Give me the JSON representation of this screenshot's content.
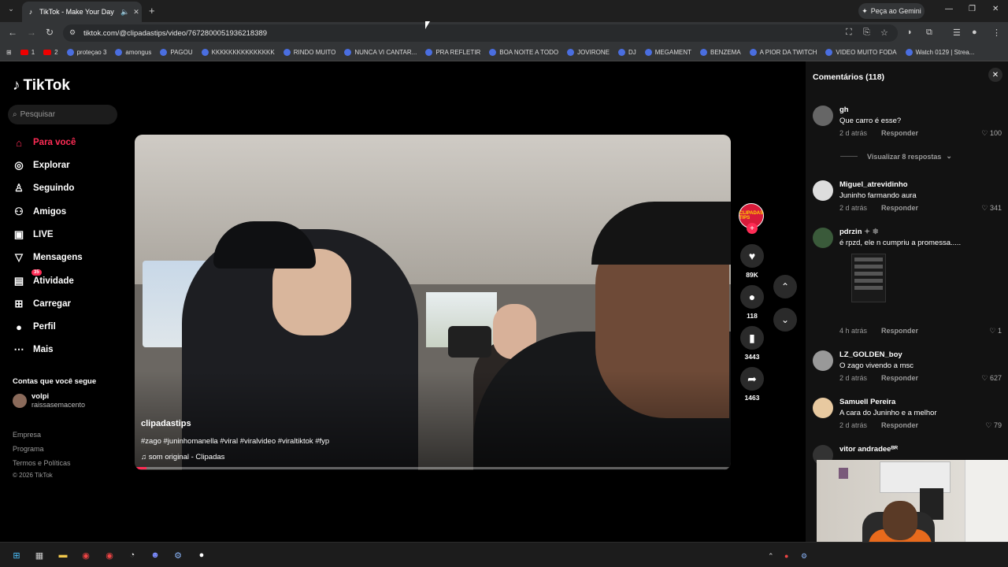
{
  "browser": {
    "tab_title": "TikTok - Make Your Day",
    "url": "tiktok.com/@clipadastips/video/7672800051936218389",
    "gemini_label": "Peça ao Gemini",
    "bookmarks": [
      "1",
      "2",
      "proteçao 3",
      "amongus",
      "PAGOU",
      "KKKKKKKKKKKKKKK",
      "RINDO MUITO",
      "NUNCA VI CANTAR...",
      "PRA REFLETIR",
      "BOA NOITE A TODO",
      "JOVIRONE",
      "DJ",
      "MEGAMENT",
      "BENZEMA",
      "A PIOR DA TWITCH",
      "VIDEO MUITO FODA",
      "Watch 0129 | Strea..."
    ]
  },
  "sidebar": {
    "logo": "TikTok",
    "search_placeholder": "Pesquisar",
    "items": [
      {
        "label": "Para você",
        "icon": "home-icon"
      },
      {
        "label": "Explorar",
        "icon": "compass-icon"
      },
      {
        "label": "Seguindo",
        "icon": "following-icon"
      },
      {
        "label": "Amigos",
        "icon": "friends-icon"
      },
      {
        "label": "LIVE",
        "icon": "live-icon"
      },
      {
        "label": "Mensagens",
        "icon": "messages-icon"
      },
      {
        "label": "Atividade",
        "icon": "activity-icon",
        "badge": "35"
      },
      {
        "label": "Carregar",
        "icon": "upload-icon"
      },
      {
        "label": "Perfil",
        "icon": "profile-icon"
      },
      {
        "label": "Mais",
        "icon": "more-icon"
      }
    ],
    "following_title": "Contas que você segue",
    "following_name": "volpi",
    "following_handle": "raissasemacento",
    "footer": [
      "Empresa",
      "Programa",
      "Termos e Políticas",
      "© 2026 TikTok"
    ]
  },
  "video": {
    "username": "clipadastips",
    "hashtags": "#zago #juninhomanella #viral #viralvideo #viraltiktok #fyp",
    "sound": "som original - Clipadas",
    "progress": 0.02,
    "avatar_text": "CLIPADAS TIPS",
    "likes": "89K",
    "comments": "118",
    "saves": "3443",
    "shares": "1463"
  },
  "comments_panel": {
    "title": "Comentários",
    "count": "(118)",
    "reply_label": "Responder",
    "view_replies": "Visualizar 8 respostas",
    "comments": [
      {
        "name": "gh",
        "text": "Que carro é esse?",
        "time": "2 d atrás",
        "likes": "100"
      },
      {
        "name": "Miguel_atrevidinho",
        "text": "Juninho farmando aura",
        "time": "2 d atrás",
        "likes": "341"
      },
      {
        "name": "pdrzin",
        "text": "é rpzd, ele n cumpriu a promessa.....",
        "time": "4 h atrás",
        "likes": "1"
      },
      {
        "name": "LZ_GOLDEN_boy",
        "text": "O zago vivendo a msc",
        "time": "2 d atrás",
        "likes": "627"
      },
      {
        "name": "Samuell Pereira",
        "text": "A cara do Juninho e a melhor",
        "time": "2 d atrás",
        "likes": "79"
      },
      {
        "name": "vitor andradeeᴮᴿ",
        "text": "",
        "time": "",
        "likes": ""
      }
    ]
  },
  "colors": {
    "accent": "#fe2c55",
    "panel": "#121212"
  }
}
